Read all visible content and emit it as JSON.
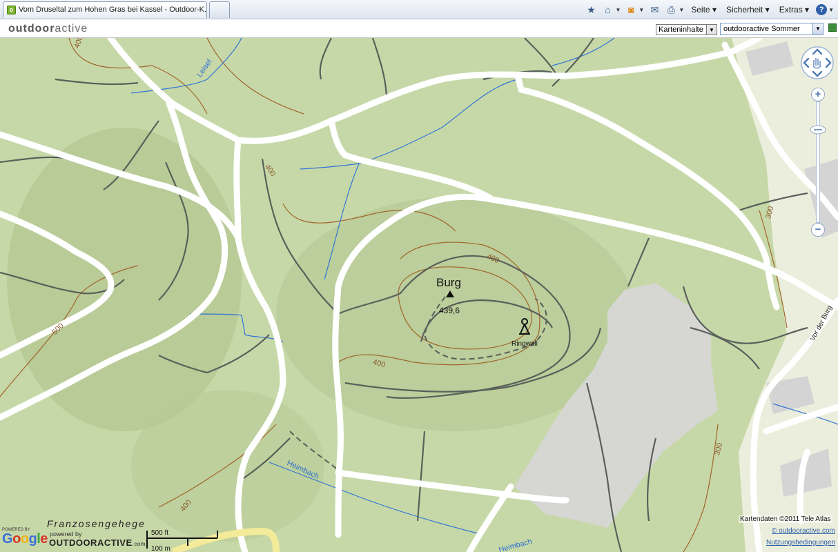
{
  "browser": {
    "tab_title": "Vom Druseltal zum Hohen Gras bei Kassel - Outdoor-K...",
    "favicon_letter": "o",
    "menus": [
      "Seite",
      "Sicherheit",
      "Extras"
    ]
  },
  "app": {
    "logo_prefix": "outdoor",
    "logo_suffix": "active",
    "contents_select": "Karteninhalte",
    "layer_select": "outdooractive Sommer"
  },
  "map": {
    "peak_name": "Burg",
    "peak_elevation": "439,6",
    "poi_label": "Ringwall",
    "street_label": "Vor der Burg",
    "area_label": "Franzosengehege",
    "water_labels": [
      "Leisel",
      "Heimbach",
      "Heimbach"
    ],
    "contour_labels": [
      "400",
      "400",
      "400",
      "400",
      "500",
      "400",
      "300",
      "300"
    ],
    "zoom_in": "+",
    "zoom_out": "−"
  },
  "footer": {
    "powered_by": "POWERED BY",
    "google": "Google",
    "od_powered_by": "powered by",
    "od_logo": "OUTDOORACTIVE",
    "od_logo_suffix": ".com",
    "scale_ft": "500 ft",
    "scale_m": "100 m",
    "copyright": "Kartendaten ©2011 Tele Atlas",
    "od_link": "© outdooractive.com",
    "terms_link": "Nutzungsbedingungen"
  },
  "colors": {
    "forest": "#c7d8a8",
    "forest_dark": "#b3c893",
    "field": "#eceedd",
    "settlement": "#d4d4d4",
    "road": "#ffffff",
    "track": "#5a5f5a",
    "contour": "#a0642a",
    "water": "#2e74d6"
  }
}
